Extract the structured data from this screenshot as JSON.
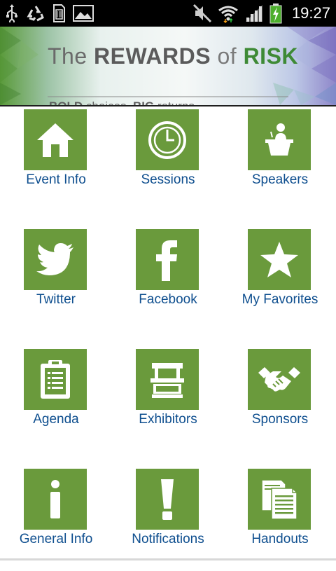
{
  "status_bar": {
    "time": "19:27",
    "left_icons": [
      "usb-icon",
      "recycle-icon",
      "sd-card-icon",
      "image-icon"
    ],
    "right_icons": [
      "mute-icon",
      "wifi-icon",
      "signal-icon",
      "battery-charging-icon"
    ]
  },
  "banner": {
    "title_the": "The",
    "title_rewards": "REWARDS",
    "title_of": "of",
    "title_risk": "RISK",
    "tagline_bold1": "BOLD",
    "tagline_text1": " choices. ",
    "tagline_bold2": "BIG",
    "tagline_text2": " returns."
  },
  "colors": {
    "tile_green": "#6a9a3c",
    "label_blue": "#0f4f8f",
    "risk_green": "#3e8a36"
  },
  "menu": [
    {
      "label": "Event Info",
      "icon": "home-icon"
    },
    {
      "label": "Sessions",
      "icon": "clock-icon"
    },
    {
      "label": "Speakers",
      "icon": "podium-icon"
    },
    {
      "label": "Twitter",
      "icon": "twitter-bird-icon"
    },
    {
      "label": "Facebook",
      "icon": "facebook-icon"
    },
    {
      "label": "My Favorites",
      "icon": "star-icon"
    },
    {
      "label": "Agenda",
      "icon": "clipboard-icon"
    },
    {
      "label": "Exhibitors",
      "icon": "booth-icon"
    },
    {
      "label": "Sponsors",
      "icon": "handshake-icon"
    },
    {
      "label": "General Info",
      "icon": "info-icon"
    },
    {
      "label": "Notifications",
      "icon": "exclamation-icon"
    },
    {
      "label": "Handouts",
      "icon": "documents-icon"
    }
  ]
}
